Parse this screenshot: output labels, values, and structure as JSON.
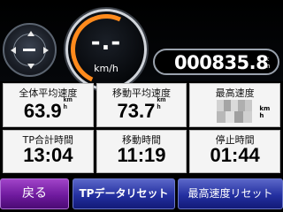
{
  "compass": {
    "heading_display": "—"
  },
  "speed": {
    "value": "-.-",
    "unit": "km/h"
  },
  "odometer": {
    "value": "000835.8",
    "unit_top": "k",
    "unit_bottom": "m"
  },
  "stats": [
    {
      "label": "全体平均速度",
      "value": "63.9",
      "unit_top": "km",
      "unit_bottom": "h"
    },
    {
      "label": "移動平均速度",
      "value": "73.7",
      "unit_top": "km",
      "unit_bottom": "h"
    },
    {
      "label": "最高速度",
      "value": "",
      "unit_top": "km",
      "unit_bottom": "h"
    },
    {
      "label": "TP合計時間",
      "value": "13:04"
    },
    {
      "label": "移動時間",
      "value": "11:19"
    },
    {
      "label": "停止時間",
      "value": "01:44"
    }
  ],
  "buttons": {
    "back": "戻る",
    "reset_tp": "TPデータリセット",
    "reset_max": "最高速度リセット"
  }
}
